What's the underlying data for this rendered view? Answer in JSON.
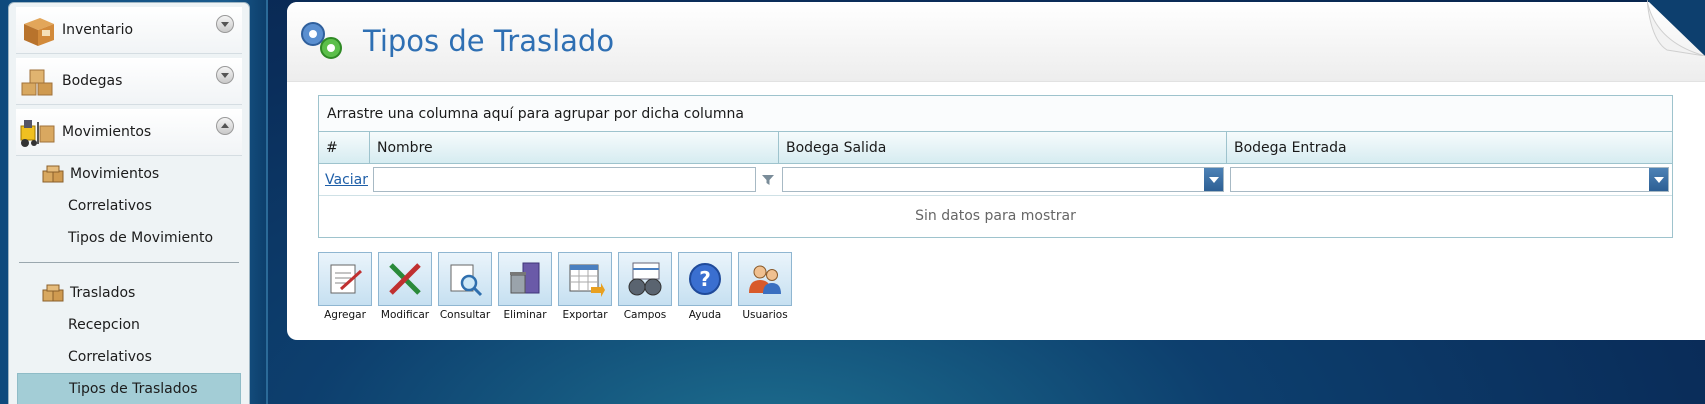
{
  "sidebar": {
    "sections": [
      {
        "label": "Inventario",
        "icon": "box-icon",
        "expanded": false
      },
      {
        "label": "Bodegas",
        "icon": "boxes-icon",
        "expanded": false
      },
      {
        "label": "Movimientos",
        "icon": "forklift-icon",
        "expanded": true
      }
    ],
    "movimientos_group": {
      "label": "Movimientos",
      "items": [
        "Correlativos",
        "Tipos de Movimiento"
      ]
    },
    "traslados_group": {
      "label": "Traslados",
      "items": [
        "Recepcion",
        "Correlativos",
        "Tipos de Traslados"
      ],
      "selected": "Tipos de Traslados"
    }
  },
  "page": {
    "title": "Tipos de Traslado"
  },
  "grid": {
    "group_prompt": "Arrastre una columna aquí para agrupar por dicha columna",
    "columns": [
      "#",
      "Nombre",
      "Bodega Salida",
      "Bodega Entrada"
    ],
    "filter_clear": "Vaciar",
    "empty_text": "Sin datos para mostrar"
  },
  "toolbar": {
    "buttons": [
      {
        "label": "Agregar",
        "icon": "add-document-icon"
      },
      {
        "label": "Modificar",
        "icon": "edit-pencil-icon"
      },
      {
        "label": "Consultar",
        "icon": "search-document-icon"
      },
      {
        "label": "Eliminar",
        "icon": "trash-icon"
      },
      {
        "label": "Exportar",
        "icon": "export-spreadsheet-icon"
      },
      {
        "label": "Campos",
        "icon": "binoculars-icon"
      },
      {
        "label": "Ayuda",
        "icon": "help-icon"
      },
      {
        "label": "Usuarios",
        "icon": "users-icon"
      }
    ]
  },
  "colors": {
    "title": "#2e6fb3",
    "selected_item": "#a3cdd6",
    "grid_border": "#9ec3cd",
    "link": "#1f5fa8"
  }
}
